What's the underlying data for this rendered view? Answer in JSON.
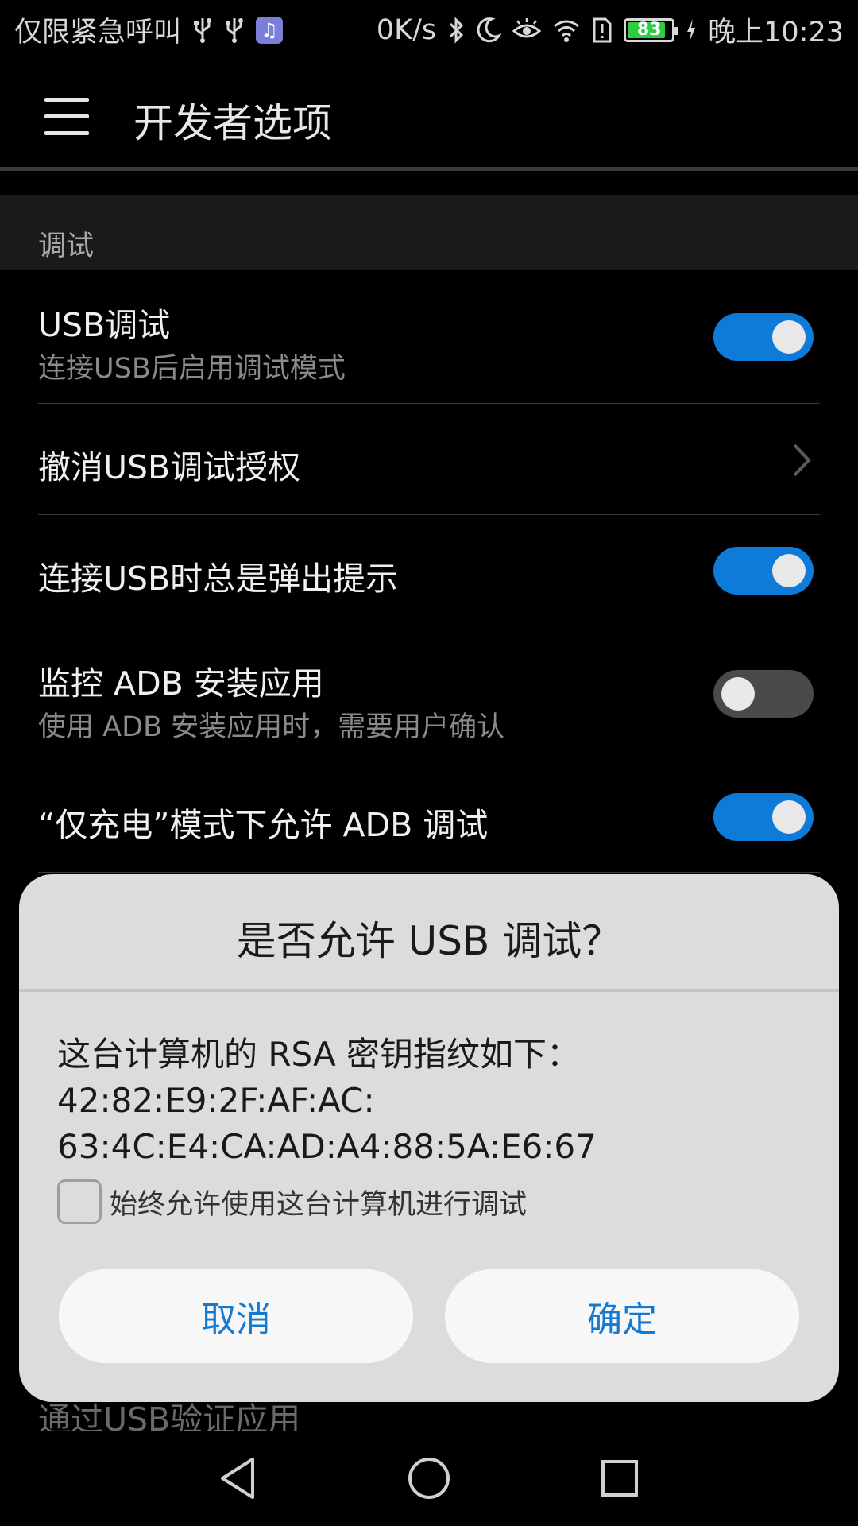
{
  "status_bar": {
    "carrier_text": "仅限紧急呼叫",
    "net_speed": "0K/s",
    "battery_level": "83",
    "time": "晚上10:23",
    "icons": [
      "usb-icon",
      "usb-icon",
      "music-app-icon",
      "bluetooth-icon",
      "moon-icon",
      "eye-icon",
      "wifi-icon",
      "alert-icon",
      "battery-icon",
      "charging-icon"
    ]
  },
  "app_bar": {
    "title": "开发者选项"
  },
  "section": {
    "header": "调试"
  },
  "settings": [
    {
      "title": "USB调试",
      "subtitle": "连接USB后启用调试模式",
      "control": "toggle",
      "checked": true
    },
    {
      "title": "撤消USB调试授权",
      "control": "chevron"
    },
    {
      "title": "连接USB时总是弹出提示",
      "control": "toggle",
      "checked": true
    },
    {
      "title": "监控 ADB 安装应用",
      "subtitle": "使用 ADB 安装应用时，需要用户确认",
      "control": "toggle",
      "checked": false
    },
    {
      "title": "“仅充电”模式下允许 ADB 调试",
      "control": "toggle",
      "checked": true
    }
  ],
  "partially_hidden_row": {
    "title": "通过USB验证应用"
  },
  "dialog": {
    "title": "是否允许 USB 调试？",
    "message_line1": "这台计算机的 RSA 密钥指纹如下：",
    "message_line2": "42:82:E9:2F:AF:AC:",
    "message_line3": "63:4C:E4:CA:AD:A4:88:5A:E6:67",
    "checkbox_label": "始终允许使用这台计算机进行调试",
    "checkbox_checked": false,
    "cancel_label": "取消",
    "ok_label": "确定"
  },
  "colors": {
    "accent": "#0d7bd7",
    "dialog_button_text": "#1479d1",
    "background": "#000000",
    "dialog_background": "#dcdcdc"
  },
  "nav_bar": {
    "icons": [
      "back-icon",
      "home-icon",
      "recents-icon"
    ]
  }
}
